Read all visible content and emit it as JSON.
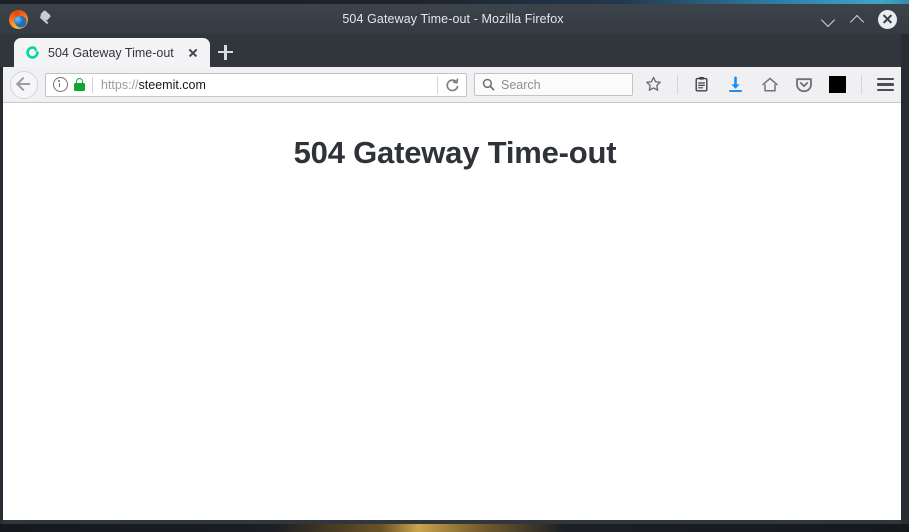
{
  "window": {
    "title": "504 Gateway Time-out - Mozilla Firefox",
    "app_icon": "firefox-logo-icon",
    "pin_icon": "pin-icon",
    "controls": {
      "minimize": "chevron-down-icon",
      "maximize": "chevron-up-icon",
      "close": "close-icon"
    }
  },
  "tabbar": {
    "tabs": [
      {
        "title": "504 Gateway Time-out",
        "favicon": "steemit-spiral-favicon",
        "close_icon": "close-icon",
        "active": true
      }
    ],
    "new_tab_icon": "plus-icon"
  },
  "navbar": {
    "back_icon": "back-arrow-icon",
    "urlbar": {
      "info_icon": "info-circle-icon",
      "lock_icon": "padlock-icon",
      "scheme": "https://",
      "host": "steemit.com",
      "full_url": "https://steemit.com",
      "reload_icon": "reload-icon"
    },
    "search": {
      "icon": "search-icon",
      "placeholder": "Search",
      "value": ""
    },
    "buttons": [
      {
        "name": "bookmark-star-button",
        "icon": "star-icon"
      },
      {
        "name": "library-button",
        "icon": "clipboard-icon"
      },
      {
        "name": "downloads-button",
        "icon": "download-arrow-icon"
      },
      {
        "name": "home-button",
        "icon": "home-icon"
      },
      {
        "name": "pocket-button",
        "icon": "pocket-shield-icon"
      },
      {
        "name": "extension-button",
        "icon": "black-square-icon"
      },
      {
        "name": "menu-button",
        "icon": "hamburger-menu-icon"
      }
    ]
  },
  "page": {
    "heading": "504 Gateway Time-out",
    "background": "#ffffff",
    "heading_color": "#2f3337"
  },
  "colors": {
    "titlebar": "#3a4048",
    "toolbar": "#f0f0f2",
    "tab_active": "#f4f4f6",
    "favicon_teal": "#06d6a0",
    "lock_green": "#12a532",
    "download_blue": "#1b8ff0"
  }
}
